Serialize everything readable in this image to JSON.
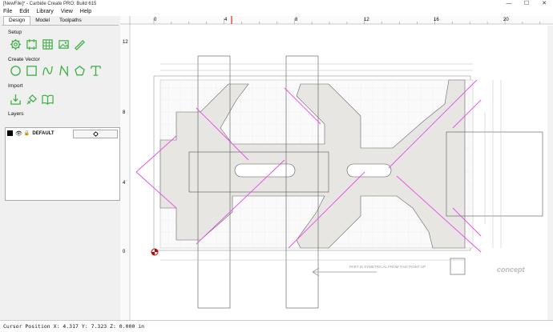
{
  "window": {
    "title": "[NewFile]* - Carbide Create PRO: Build 615",
    "min": "—",
    "max": "☐",
    "close": "✕"
  },
  "menu": [
    "File",
    "Edit",
    "Library",
    "View",
    "Help"
  ],
  "tabs": [
    "Design",
    "Model",
    "Toolpaths"
  ],
  "sections": {
    "setup": "Setup",
    "create_vector": "Create Vector",
    "import": "Import",
    "layers": "Layers"
  },
  "layers": [
    {
      "name": "DEFAULT"
    }
  ],
  "ruler": {
    "h_ticks": [
      "0",
      "4",
      "8",
      "12",
      "16",
      "20"
    ],
    "v_ticks": [
      "12",
      "8",
      "4",
      "0"
    ]
  },
  "drawing": {
    "note": "PART IS SYMETRICAL FROM THIS POINT UP",
    "logo": "concept"
  },
  "status": {
    "cursor": "Cursor Position X: 4.317 Y: 7.323 Z: 0.000 in"
  },
  "colors": {
    "accent": "#3cb043",
    "cut": "#e64de6",
    "part": "#e8e6e3"
  },
  "icons": {
    "setup": [
      "gear-icon",
      "job-setup-icon",
      "grid-icon",
      "image-icon",
      "material-icon"
    ],
    "create": [
      "circle-icon",
      "rectangle-icon",
      "curve-icon",
      "polyline-icon",
      "polygon-icon",
      "text-icon"
    ],
    "import": [
      "import-icon",
      "import-shapes-icon",
      "library-book-icon"
    ]
  }
}
